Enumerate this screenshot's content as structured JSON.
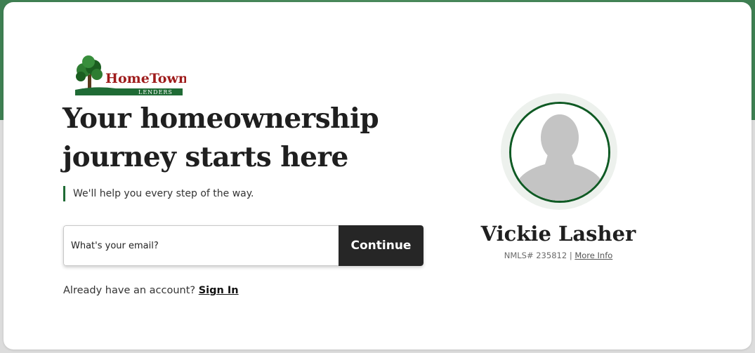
{
  "brand": {
    "logo_name": "HomeTown",
    "logo_sub": "LENDERS",
    "accent_color": "#1f6b35",
    "logo_red": "#9e1b1b"
  },
  "hero": {
    "headline": "Your homeownership journey starts here",
    "subline": "We'll help you every step of the way."
  },
  "form": {
    "email_placeholder": "What's your email?",
    "email_value": "",
    "continue_label": "Continue"
  },
  "account": {
    "prompt": "Already have an account?",
    "sign_in_label": "Sign In"
  },
  "agent": {
    "name": "Vickie Lasher",
    "nmls_text": "NMLS# 235812",
    "separator": "|",
    "more_info_label": "More Info",
    "avatar_icon": "default-user-silhouette-icon"
  }
}
